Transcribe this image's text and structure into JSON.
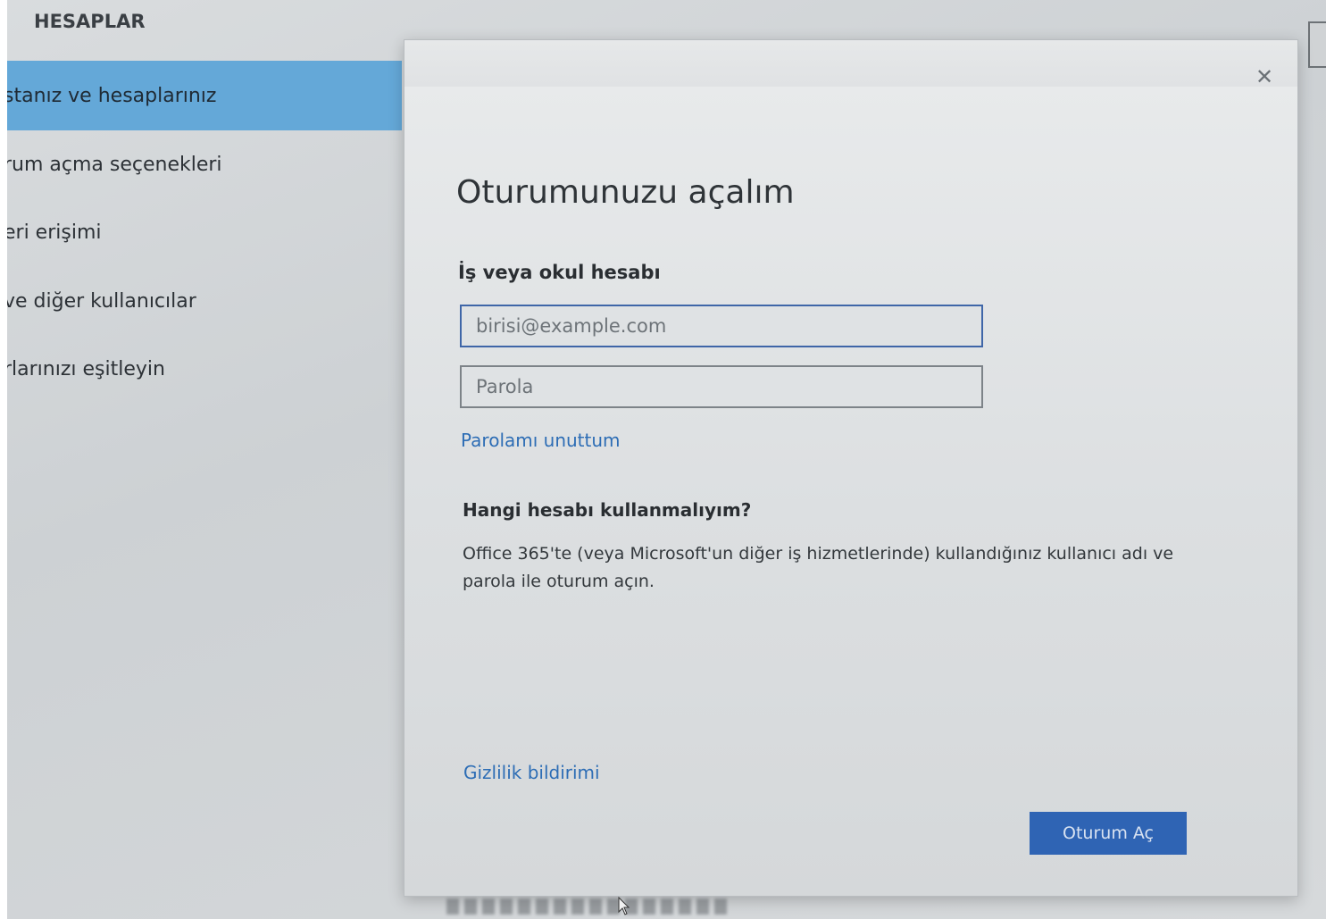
{
  "settings": {
    "section_title": "HESAPLAR",
    "nav_items": [
      {
        "label": "stanız ve hesaplarınız",
        "selected": true
      },
      {
        "label": "rum açma seçenekleri",
        "selected": false
      },
      {
        "label": "eri erişimi",
        "selected": false
      },
      {
        "label": "ve diğer kullanıcılar",
        "selected": false
      },
      {
        "label": "rlarınızı eşitleyin",
        "selected": false
      }
    ]
  },
  "dialog": {
    "close_icon": "close-icon",
    "title": "Oturumunuzu açalım",
    "account_label": "İş veya okul hesabı",
    "email_placeholder": "birisi@example.com",
    "password_placeholder": "Parola",
    "forgot_password": "Parolamı unuttum",
    "help_heading": "Hangi hesabı kullanmalıyım?",
    "help_text": "Office 365'te (veya Microsoft'un diğer iş hizmetlerinde) kullandığınız kullanıcı adı ve parola ile oturum açın.",
    "privacy_link": "Gizlilik bildirimi",
    "signin_button": "Oturum Aç"
  },
  "colors": {
    "selected_nav": "#64a8d8",
    "link": "#2d6db5",
    "primary_button": "#2f64b4",
    "email_focus_border": "#3f66a8"
  }
}
